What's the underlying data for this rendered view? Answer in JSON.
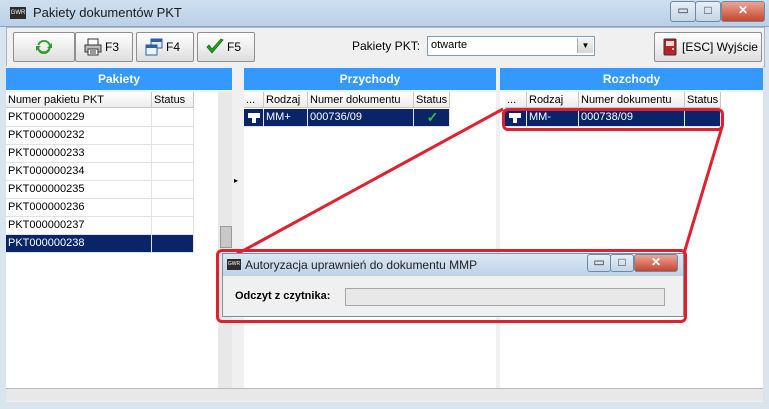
{
  "window": {
    "title": "Pakiety dokumentów PKT",
    "logo_text": "GWR",
    "min_symbol": "▭",
    "max_symbol": "□",
    "close_symbol": "✕"
  },
  "toolbar": {
    "refresh_icon": "refresh-icon",
    "print_label": "F3",
    "print_icon": "printer-icon",
    "f4_label": "F4",
    "f4_icon": "windows-icon",
    "f5_label": "F5",
    "f5_icon": "checkmark-icon",
    "filter_label": "Pakiety PKT:",
    "filter_value": "otwarte",
    "exit_label": "[ESC] Wyjście",
    "exit_icon": "door-exit-icon"
  },
  "pakiety": {
    "header": "Pakiety",
    "columns": [
      "Numer pakietu PKT",
      "Status"
    ],
    "rows": [
      "PKT000000229",
      "PKT000000232",
      "PKT000000233",
      "PKT000000234",
      "PKT000000235",
      "PKT000000236",
      "PKT000000237",
      "PKT000000238"
    ],
    "selected_index": 7
  },
  "przychody": {
    "header": "Przychody",
    "columns": [
      "...",
      "Rodzaj",
      "Numer dokumentu",
      "Status"
    ],
    "rows": [
      {
        "rodzaj": "MM+",
        "numer": "000736/09",
        "status": "✓"
      }
    ]
  },
  "rozchody": {
    "header": "Rozchody",
    "columns": [
      "...",
      "Rodzaj",
      "Numer dokumentu",
      "Status"
    ],
    "rows": [
      {
        "rodzaj": "MM-",
        "numer": "000738/09",
        "status": ""
      }
    ]
  },
  "dialog": {
    "title": "Autoryzacja uprawnień do dokumentu MMP",
    "logo_text": "GWR",
    "field_label": "Odczyt z czytnika:",
    "field_value": ""
  },
  "colors": {
    "header_blue": "#3399ff",
    "selection": "#0a246a",
    "annotation_red": "#e0202e"
  }
}
